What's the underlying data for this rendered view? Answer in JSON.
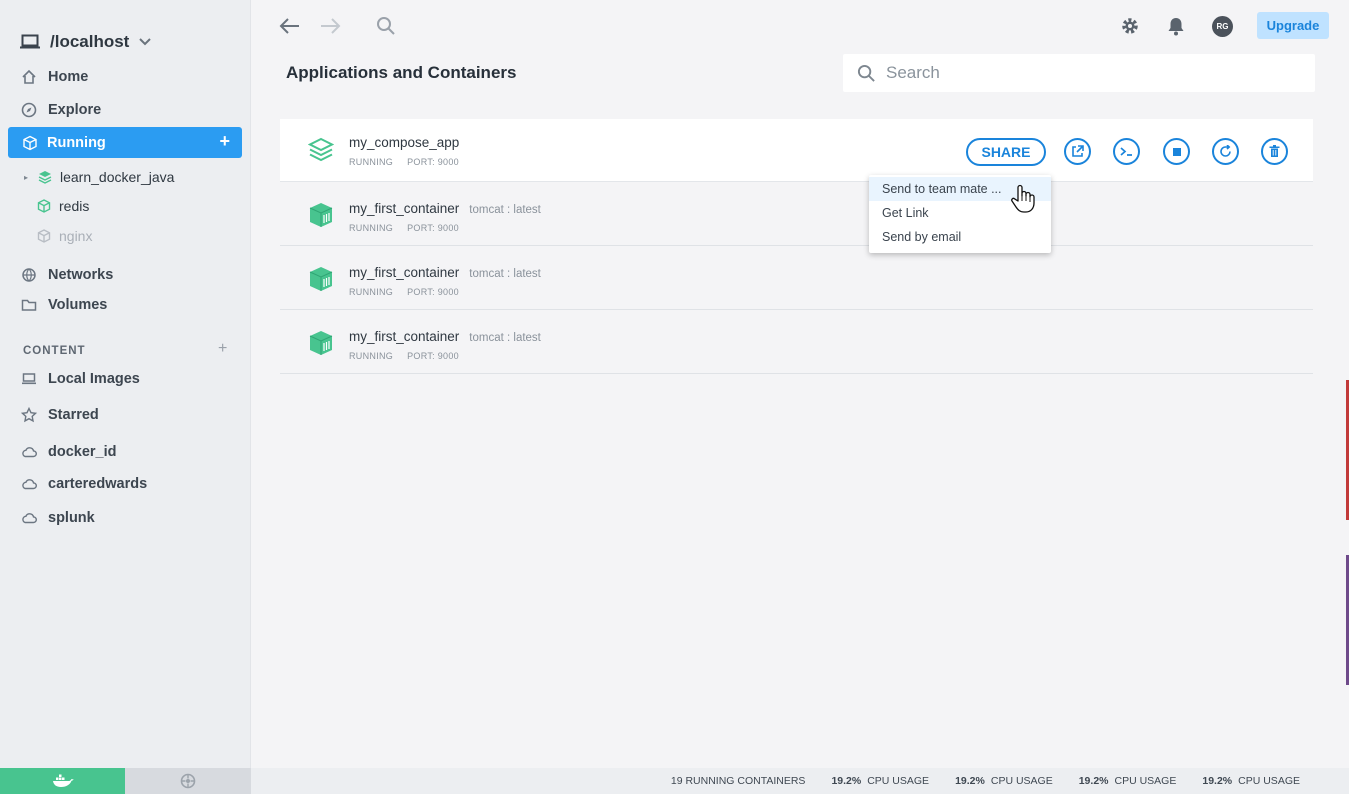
{
  "sidebar": {
    "host": "/localhost",
    "nav": {
      "home": "Home",
      "explore": "Explore",
      "running": "Running",
      "networks": "Networks",
      "volumes": "Volumes"
    },
    "running_children": [
      {
        "label": "learn_docker_java"
      },
      {
        "label": "redis"
      },
      {
        "label": "nginx"
      }
    ],
    "content_heading": "CONTENT",
    "content_items": {
      "local_images": "Local Images",
      "starred": "Starred",
      "docker_id": "docker_id",
      "carteredwards": "carteredwards",
      "splunk": "splunk"
    }
  },
  "toolbar": {
    "avatar_initials": "RG",
    "upgrade_label": "Upgrade"
  },
  "main": {
    "title": "Applications and Containers",
    "search_placeholder": "Search",
    "rows": [
      {
        "name": "my_compose_app",
        "tag": "",
        "status": "RUNNING",
        "port": "PORT: 9000"
      },
      {
        "name": "my_first_container",
        "tag": "tomcat : latest",
        "status": "RUNNING",
        "port": "PORT: 9000"
      },
      {
        "name": "my_first_container",
        "tag": "tomcat : latest",
        "status": "RUNNING",
        "port": "PORT: 9000"
      },
      {
        "name": "my_first_container",
        "tag": "tomcat : latest",
        "status": "RUNNING",
        "port": "PORT: 9000"
      }
    ],
    "share_label": "SHARE",
    "share_menu": [
      "Send to team mate ...",
      "Get Link",
      "Send by email"
    ]
  },
  "statusbar": {
    "running_containers": "19 RUNNING CONTAINERS",
    "cpu": [
      {
        "value": "19.2%",
        "label": "CPU USAGE"
      },
      {
        "value": "19.2%",
        "label": "CPU USAGE"
      },
      {
        "value": "19.2%",
        "label": "CPU USAGE"
      },
      {
        "value": "19.2%",
        "label": "CPU USAGE"
      }
    ]
  },
  "colors": {
    "accent": "#2b9cf2",
    "link_blue": "#1a84db",
    "green": "#48c48f"
  }
}
